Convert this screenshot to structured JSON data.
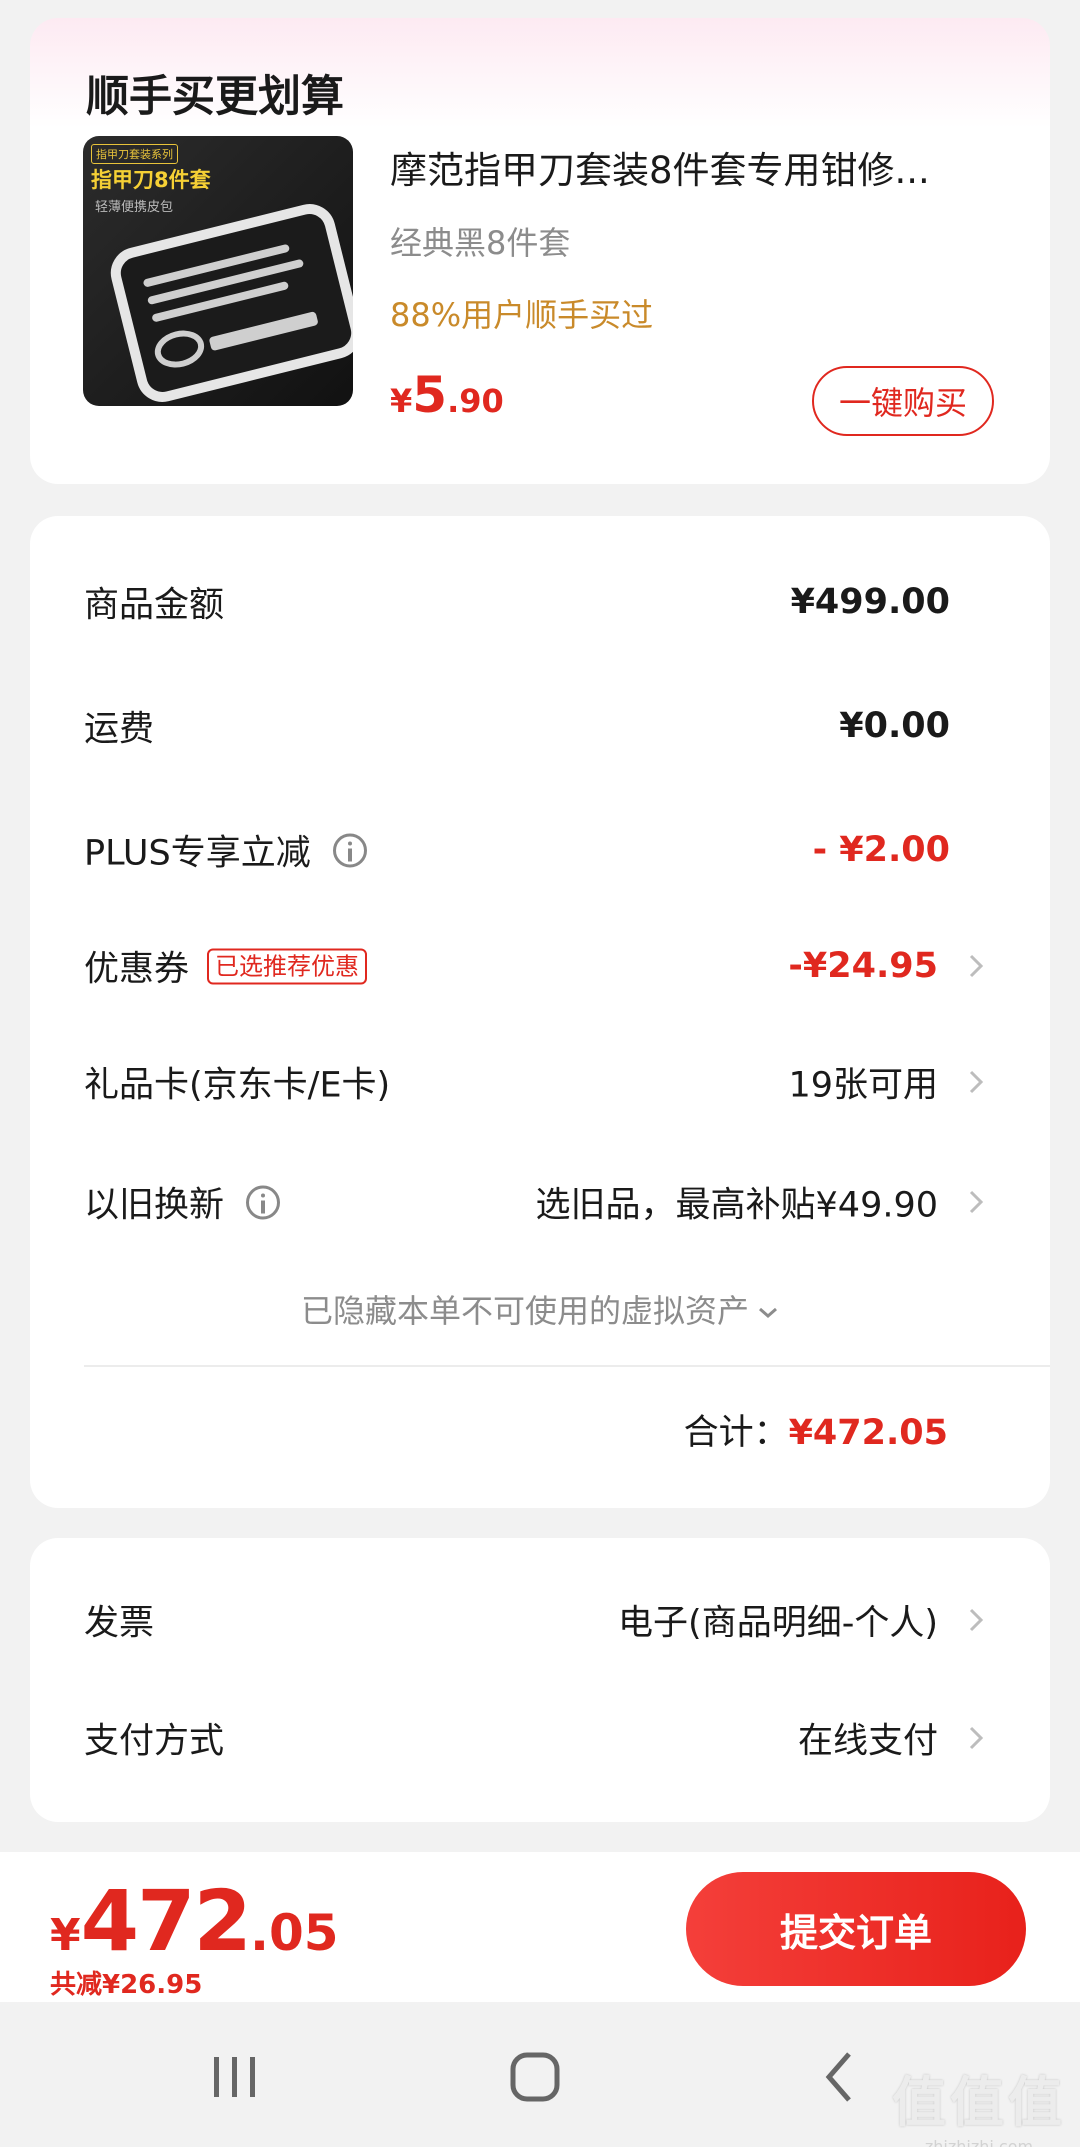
{
  "recommend": {
    "title": "顺手买更划算",
    "image_tag_small": "指甲刀套装系列",
    "image_tag_big": "指甲刀8件套",
    "image_tag_sub": "轻薄便携皮包",
    "product_name": "摩范指甲刀套装8件套专用钳修...",
    "spec": "经典黑8件套",
    "stat": "88%用户顺手买过",
    "price_currency": "¥",
    "price_int": "5",
    "price_dec": ".90",
    "buy_label": "一键购买"
  },
  "costs": {
    "items": [
      {
        "label": "商品金额",
        "value": "¥499.00"
      },
      {
        "label": "运费",
        "value": "¥0.00"
      },
      {
        "label": "PLUS专享立减",
        "value": "- ¥2.00"
      },
      {
        "label": "优惠券",
        "badge": "已选推荐优惠",
        "value": "-¥24.95"
      },
      {
        "label": "礼品卡(京东卡/E卡)",
        "value": "19张可用"
      },
      {
        "label": "以旧换新",
        "value": "选旧品，最高补贴¥49.90"
      }
    ],
    "hidden_note": "已隐藏本单不可使用的虚拟资产",
    "total_label": "合计：",
    "total_value": "¥472.05"
  },
  "payment": {
    "invoice_label": "发票",
    "invoice_value": "电子(商品明细-个人)",
    "method_label": "支付方式",
    "method_value": "在线支付"
  },
  "bottom": {
    "price_currency": "¥",
    "price_int": "472",
    "price_dec": ".05",
    "saved": "共减¥26.95",
    "submit_label": "提交订单"
  },
  "watermark": {
    "big": "值值值",
    "small": "zhizhizhi.com"
  },
  "colors": {
    "accent_red": "#e0281f",
    "stat_orange": "#c98a2a",
    "muted": "#8c8c8c"
  }
}
